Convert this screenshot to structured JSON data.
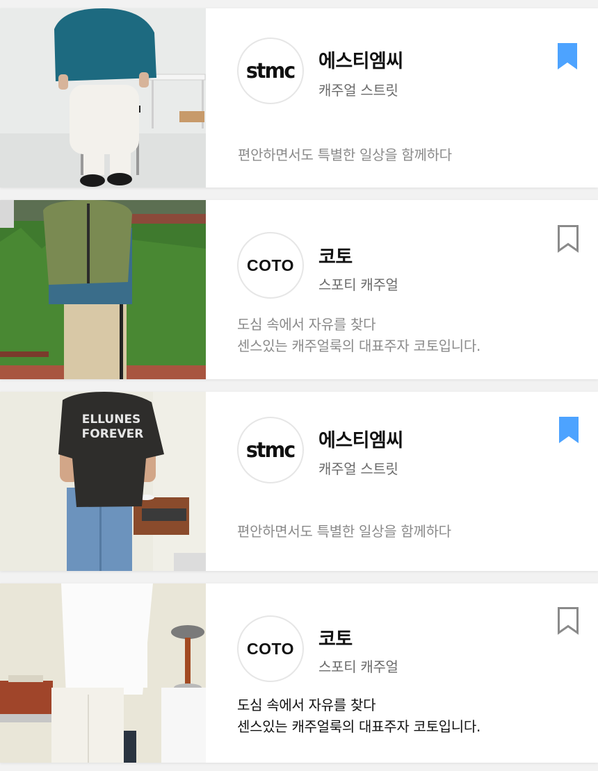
{
  "brands": [
    {
      "name": "에스티엠씨",
      "category": "캐주얼 스트릿",
      "logo_text": "stmc",
      "description": [
        "편안하면서도 특별한 일상을 함께하다"
      ],
      "bookmarked": true
    },
    {
      "name": "코토",
      "category": "스포티 캐주얼",
      "logo_text": "COTO",
      "description": [
        "도심 속에서 자유를 찾다",
        "센스있는 캐주얼룩의 대표주자 코토입니다."
      ],
      "bookmarked": false
    },
    {
      "name": "에스티엠씨",
      "category": "캐주얼 스트릿",
      "logo_text": "stmc",
      "description": [
        "편안하면서도 특별한 일상을 함께하다"
      ],
      "bookmarked": true
    },
    {
      "name": "코토",
      "category": "스포티 캐주얼",
      "logo_text": "COTO",
      "description": [
        "도심 속에서 자유를 찾다",
        "센스있는 캐주얼룩의 대표주자 코토입니다."
      ],
      "bookmarked": false
    }
  ],
  "photo_texts": {
    "tshirt_print": [
      "ELLUNES",
      "FOREVER"
    ]
  },
  "colors": {
    "bookmark_active": "#4da3ff",
    "bookmark_inactive": "#8a8a8a",
    "text_primary": "#111111",
    "text_secondary": "#6b6b6b"
  }
}
